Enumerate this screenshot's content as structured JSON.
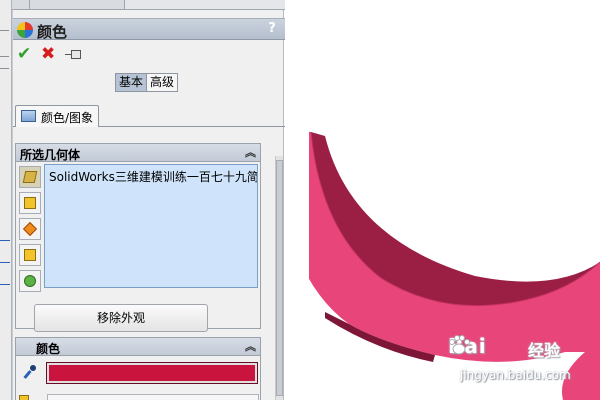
{
  "property_manager": {
    "title": "颜色",
    "help": "?",
    "ok_icon": "check-icon",
    "cancel_icon": "x-icon",
    "pin_icon": "pushpin-icon",
    "mode": {
      "basic": "基本",
      "advanced": "高级",
      "selected": "basic"
    },
    "tab": {
      "label": "颜色/图象",
      "icon": "image-icon"
    }
  },
  "selected_geometry": {
    "title": "所选几何体",
    "collapse_glyph": "︽",
    "filter_icons": [
      "part-filter-icon",
      "body-filter-icon",
      "face-filter-icon",
      "feature-filter-icon",
      "add-face-filter-icon"
    ],
    "items": [
      "SolidWorks三维建模训练一百七十九简单"
    ],
    "remove_button": "移除外观"
  },
  "color_group": {
    "title": "颜色",
    "collapse_glyph": "︽",
    "eyedropper_icon": "eyedropper-icon",
    "swatch_color": "#c9143e"
  },
  "graphics": {
    "model_color": "#e8457a",
    "model_shadow_color": "#9b1f45"
  },
  "watermark": {
    "brand": "Bai",
    "brand_suffix": "经验",
    "url": "jingyan.baidu.com"
  }
}
